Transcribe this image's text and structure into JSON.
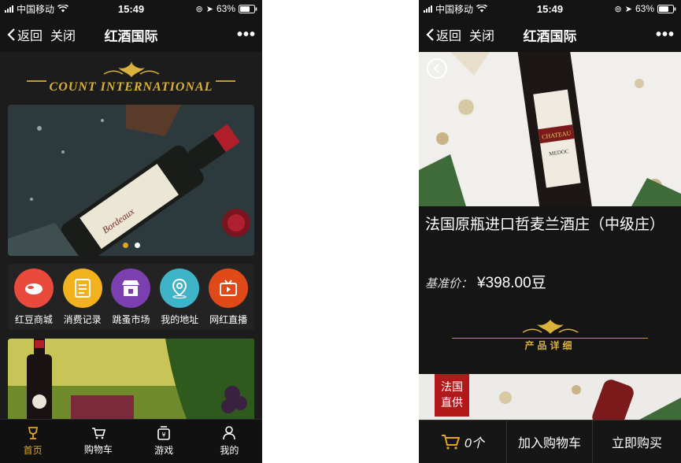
{
  "left": {
    "status": {
      "carrier": "中国移动",
      "time": "15:49",
      "battery": "63%"
    },
    "nav": {
      "back": "返回",
      "close": "关闭",
      "title": "红酒国际",
      "more": "•••"
    },
    "brand": {
      "text": "COUNT INTERNATIONAL"
    },
    "banner": {
      "slide_count": 2,
      "active_slide": 1
    },
    "quick_menu": [
      {
        "label": "红豆商城",
        "icon": "beans-icon",
        "color": "#e94a3b"
      },
      {
        "label": "消费记录",
        "icon": "receipt-icon",
        "color": "#f2b21d"
      },
      {
        "label": "跳蚤市场",
        "icon": "market-icon",
        "color": "#7c3fb0"
      },
      {
        "label": "我的地址",
        "icon": "location-icon",
        "color": "#3fb3c7"
      },
      {
        "label": "网红直播",
        "icon": "live-tv-icon",
        "color": "#e04a18"
      }
    ],
    "tabs": [
      {
        "label": "首页",
        "icon": "wine-glass-icon",
        "active": true
      },
      {
        "label": "购物车",
        "icon": "cart-icon",
        "active": false
      },
      {
        "label": "游戏",
        "icon": "game-icon",
        "active": false
      },
      {
        "label": "我的",
        "icon": "user-icon",
        "active": false
      }
    ]
  },
  "right": {
    "status": {
      "carrier": "中国移动",
      "time": "15:49",
      "battery": "63%"
    },
    "nav": {
      "back": "返回",
      "close": "关闭",
      "title": "红酒国际",
      "more": "•••"
    },
    "product": {
      "title": "法国原瓶进口哲麦兰酒庄（中级庄）",
      "price_label": "基准价：",
      "price_value": "¥398.00豆"
    },
    "section": {
      "title": "产品详细"
    },
    "origin_badge": {
      "line1": "法国",
      "line2": "直供"
    },
    "buy_bar": {
      "cart_count": "0个",
      "add_to_cart": "加入购物车",
      "buy_now": "立即购买"
    }
  },
  "colors": {
    "gold": "#d9b13b",
    "active_tab": "#e0a620",
    "badge_red": "#b21a1a"
  }
}
